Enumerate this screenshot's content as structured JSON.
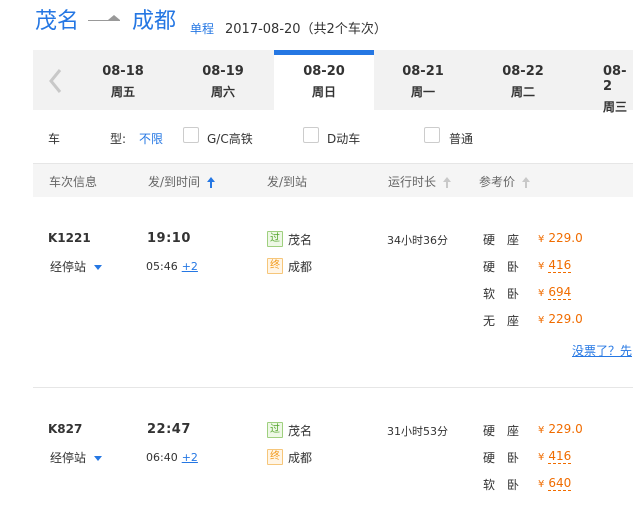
{
  "header": {
    "from": "茂名",
    "to": "成都",
    "trip_type": "单程",
    "summary": "2017-08-20（共2个车次）"
  },
  "dates": [
    {
      "date": "08-18",
      "weekday": "周五"
    },
    {
      "date": "08-19",
      "weekday": "周六"
    },
    {
      "date": "08-20",
      "weekday": "周日"
    },
    {
      "date": "08-21",
      "weekday": "周一"
    },
    {
      "date": "08-22",
      "weekday": "周二"
    },
    {
      "date": "08-2",
      "weekday": "周三"
    }
  ],
  "active_date_index": 2,
  "filter": {
    "label": "车  型:",
    "value": "不限",
    "options": [
      "G/C高铁",
      "D动车",
      "普通"
    ]
  },
  "table_header": [
    "车次信息",
    "发/到时间",
    "发/到站",
    "运行时长",
    "参考价"
  ],
  "trains": [
    {
      "no": "K1221",
      "stops_label": "经停站",
      "dep_time": "19:10",
      "arr_time": "05:46",
      "plus_days": "+2",
      "from_badge": "过",
      "from_station": "茂名",
      "to_badge": "终",
      "to_station": "成都",
      "duration": "34小时36分",
      "seats": [
        {
          "name": "硬座",
          "price": "229.0",
          "dashed": false
        },
        {
          "name": "硬卧",
          "price": "416",
          "dashed": true
        },
        {
          "name": "软卧",
          "price": "694",
          "dashed": true
        },
        {
          "name": "无座",
          "price": "229.0",
          "dashed": false
        }
      ],
      "link": "没票了？先"
    },
    {
      "no": "K827",
      "stops_label": "经停站",
      "dep_time": "22:47",
      "arr_time": "06:40",
      "plus_days": "+2",
      "from_badge": "过",
      "from_station": "茂名",
      "to_badge": "终",
      "to_station": "成都",
      "duration": "31小时53分",
      "seats": [
        {
          "name": "硬座",
          "price": "229.0",
          "dashed": false
        },
        {
          "name": "硬卧",
          "price": "416",
          "dashed": true
        },
        {
          "name": "软卧",
          "price": "640",
          "dashed": true
        }
      ]
    }
  ],
  "colors": {
    "accent": "#2577e3",
    "price": "#f06c00",
    "pass_badge": "#55a52e",
    "end_badge": "#f29b1e"
  },
  "currency_symbol": "¥"
}
